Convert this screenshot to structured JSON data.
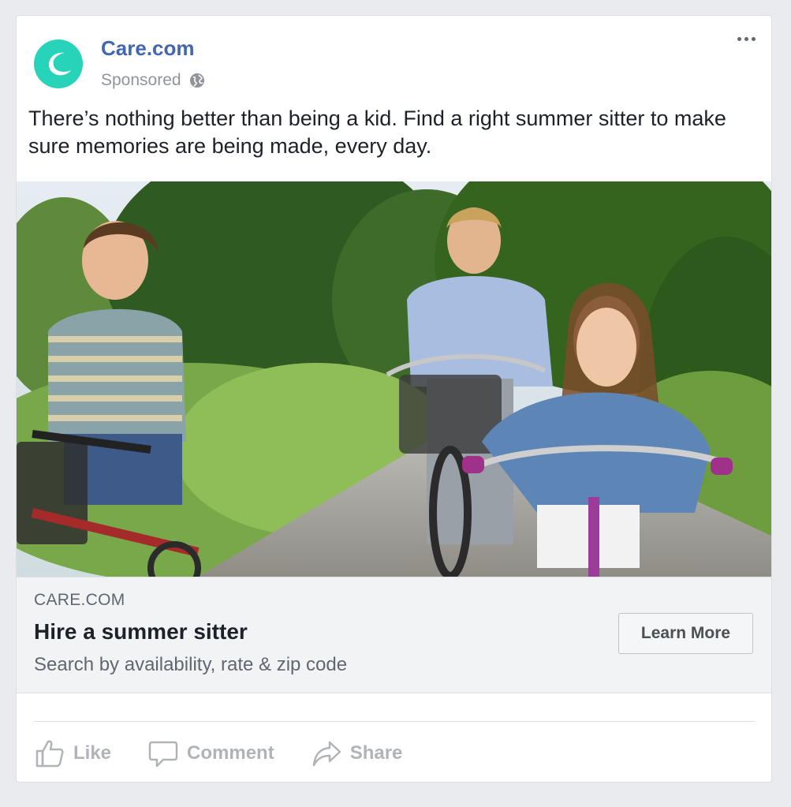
{
  "post": {
    "page_name": "Care.com",
    "sponsored_label": "Sponsored",
    "text": "There’s nothing better than being a kid. Find a right summer sitter to make sure memories are being made, every day."
  },
  "link_preview": {
    "domain": "CARE.COM",
    "headline": "Hire a summer sitter",
    "description": "Search by availability, rate & zip code",
    "cta_label": "Learn More"
  },
  "actions": {
    "like_label": "Like",
    "comment_label": "Comment",
    "share_label": "Share"
  },
  "icons": {
    "avatar": "care-logo-icon",
    "privacy": "globe-icon",
    "menu": "more-options-icon",
    "like": "thumbs-up-icon",
    "comment": "comment-bubble-icon",
    "share": "share-arrow-icon"
  },
  "colors": {
    "brand_teal": "#27d3b9",
    "link_blue": "#4267b2",
    "muted_text": "#90949c"
  }
}
